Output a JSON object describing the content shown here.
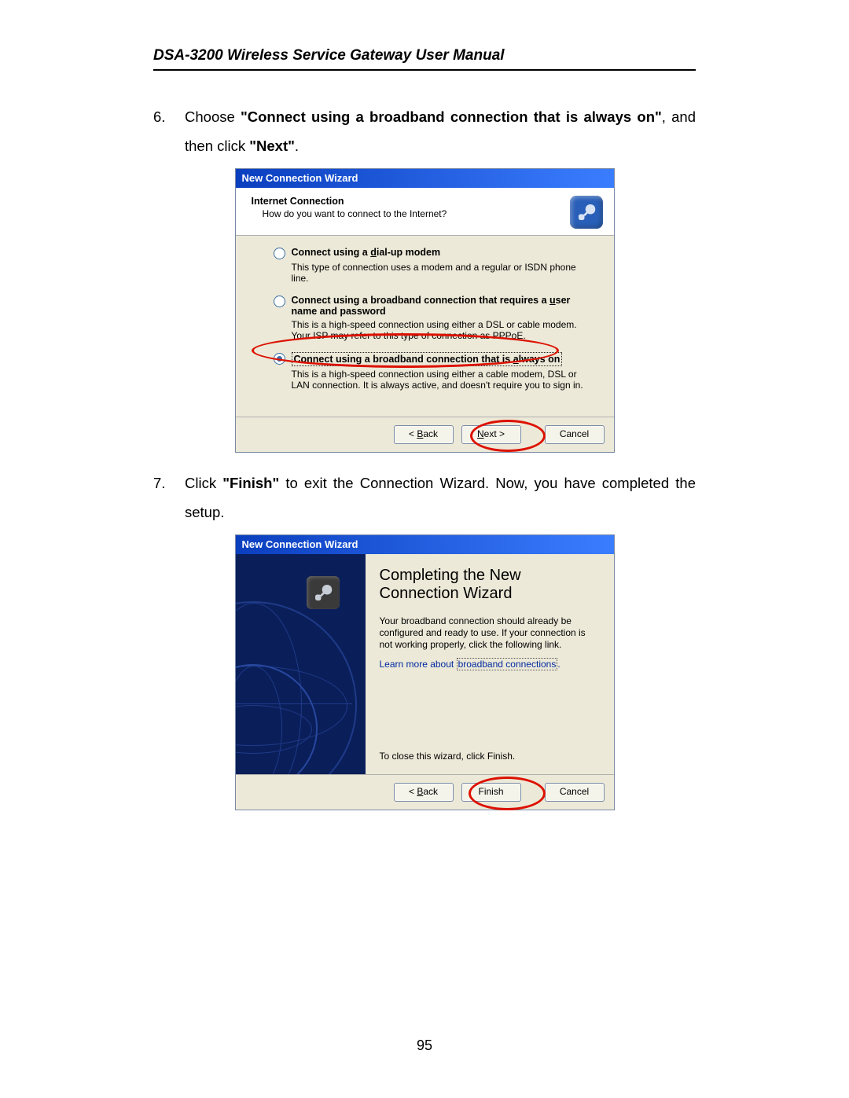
{
  "doc_header": "DSA-3200 Wireless Service Gateway User Manual",
  "page_number": "95",
  "steps": [
    {
      "num": "6.",
      "prefix": "Choose ",
      "bold1": "\"Connect using a broadband connection that is always on\"",
      "mid": ", and then click ",
      "bold2": "\"Next\"",
      "suffix": "."
    },
    {
      "num": "7.",
      "prefix": "Click ",
      "bold1": "\"Finish\"",
      "mid": " to exit the Connection Wizard. Now, you have completed the setup.",
      "bold2": "",
      "suffix": ""
    }
  ],
  "wizard1": {
    "title": "New Connection Wizard",
    "header_title": "Internet Connection",
    "header_sub": "How do you want to connect to the Internet?",
    "opts": [
      {
        "label_pre": "Connect using a ",
        "label_ul": "d",
        "label_post": "ial-up modem",
        "desc": "This type of connection uses a modem and a regular or ISDN phone line."
      },
      {
        "label_pre": "Connect using a broadband connection that requires a ",
        "label_ul": "u",
        "label_post": "ser name and password",
        "desc": "This is a high-speed connection using either a DSL or cable modem. Your ISP may refer to this type of connection as PPPoE."
      },
      {
        "label_pre": "Connect using a broadband connection that is ",
        "label_ul": "a",
        "label_post": "lways on",
        "desc": "This is a high-speed connection using either a cable modem, DSL or LAN connection. It is always active, and doesn't require you to sign in."
      }
    ],
    "buttons": {
      "back_pre": "< ",
      "back_ul": "B",
      "back_post": "ack",
      "next_ul": "N",
      "next_post": "ext >",
      "cancel": "Cancel"
    }
  },
  "wizard2": {
    "title": "New Connection Wizard",
    "complete_title": "Completing the New Connection Wizard",
    "desc": "Your broadband connection should already be configured and ready to use. If your connection is not working properly, click the following link.",
    "learn_pre": "Learn more about ",
    "learn_link": "broadband connections",
    "learn_post": ".",
    "close_text": "To close this wizard, click Finish.",
    "buttons": {
      "back_pre": "< ",
      "back_ul": "B",
      "back_post": "ack",
      "finish": "Finish",
      "cancel": "Cancel"
    }
  }
}
